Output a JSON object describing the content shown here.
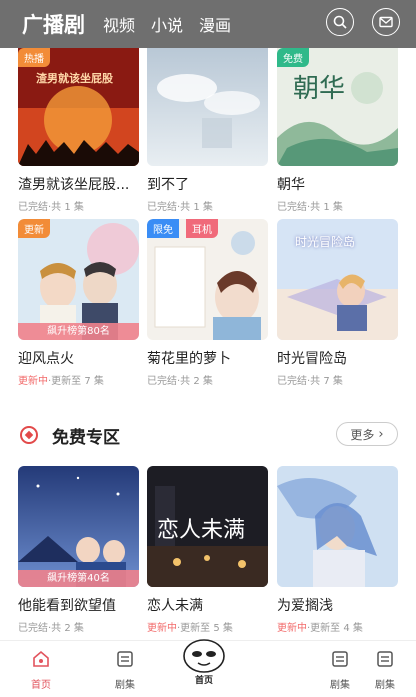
{
  "header": {
    "tabs": [
      "广播剧",
      "视频",
      "小说",
      "漫画"
    ],
    "active_tab": "广播剧"
  },
  "row1": [
    {
      "title": "渣男就该坐屁股...",
      "meta": "已完结·共 1 集",
      "badge": "热播",
      "cover_text": "渣男就该坐屁股"
    },
    {
      "title": "到不了",
      "meta": "已完结·共 1 集"
    },
    {
      "title": "朝华",
      "meta": "已完结·共 1 集",
      "badge": "免费",
      "cover_text": "朝华"
    }
  ],
  "row2": [
    {
      "title": "迎风点火",
      "meta_hl": "更新中",
      "meta_rest": "·更新至 7 集",
      "badge": "更新",
      "rank": "飙升榜第80名"
    },
    {
      "title": "菊花里的萝卜",
      "meta": "已完结·共 2 集",
      "badge": "限免",
      "badge2": "耳机"
    },
    {
      "title": "时光冒险岛",
      "meta": "已完结·共 7 集",
      "cover_text": "时光冒险岛"
    }
  ],
  "section": {
    "title": "免费专区",
    "more": "更多"
  },
  "row3": [
    {
      "title": "他能看到欲望值",
      "meta": "已完结·共 2 集",
      "rank": "飙升榜第40名"
    },
    {
      "title": "恋人未满",
      "meta_hl": "更新中",
      "meta_rest": "·更新至 5 集",
      "cover_text": "恋人未满"
    },
    {
      "title": "为爱搁浅",
      "meta_hl": "更新中",
      "meta_rest": "·更新至 4 集"
    }
  ],
  "bottom_nav": {
    "home": "首页",
    "drama1": "剧集",
    "drama2": "剧集",
    "drama3": "剧集"
  },
  "mascot_label": "首页"
}
